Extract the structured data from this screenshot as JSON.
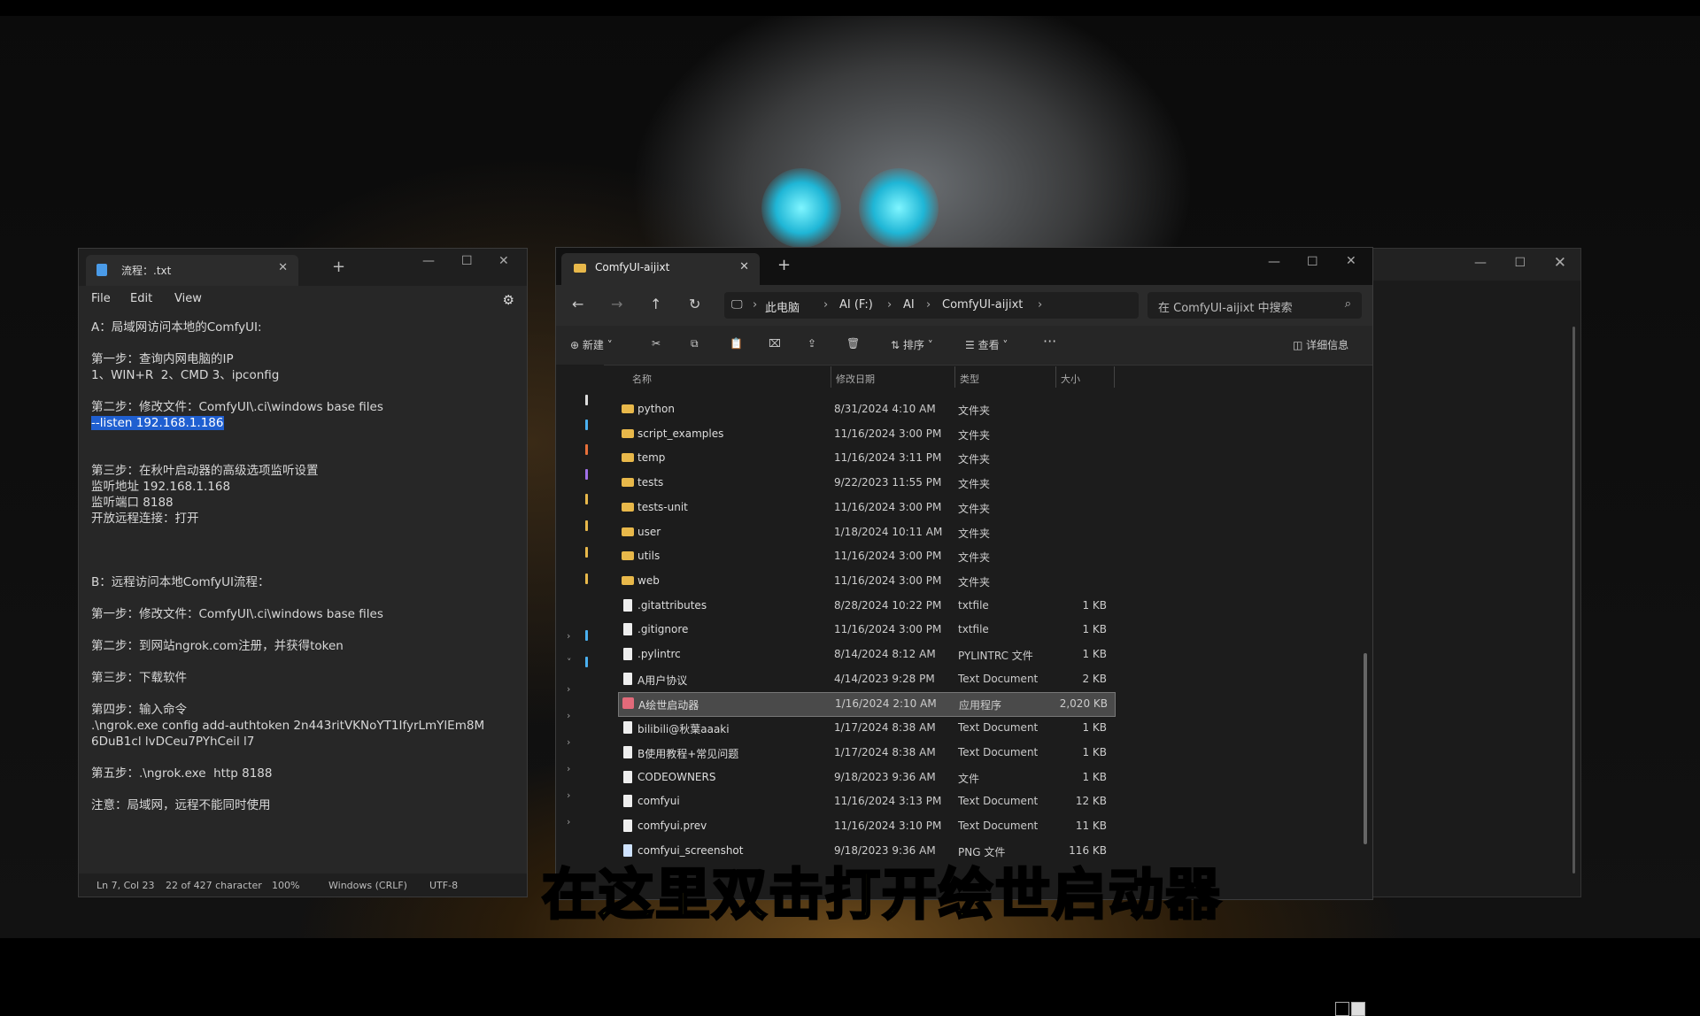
{
  "notepad": {
    "tab_title": "流程：.txt",
    "menu": [
      "File",
      "Edit",
      "View"
    ],
    "lines": [
      "A：局域网访问本地的ComfyUI:",
      "",
      "第一步：查询内网电脑的IP",
      "1、WIN+R  2、CMD 3、ipconfig",
      "",
      "第二步：修改文件：ComfyUI\\.ci\\windows base files",
      "",
      "",
      "第三步：在秋叶启动器的高级选项监听设置",
      "监听地址 192.168.1.168",
      "监听端口 8188",
      "开放远程连接：打开",
      "",
      "",
      "",
      "B：远程访问本地ComfyUI流程：",
      "",
      "第一步：修改文件：ComfyUI\\.ci\\windows base files",
      "",
      "第二步：到网站ngrok.com注册，并获得token",
      "",
      "第三步：下载软件",
      "",
      "第四步：输入命令",
      ".\\ngrok.exe config add-authtoken 2n443ritVKNoYT1IfyrLmYlEm8M",
      "6DuB1cl lvDCeu7PYhCeil l7",
      "",
      "第五步：.\\ngrok.exe  http 8188",
      "",
      "注意：局域网，远程不能同时使用"
    ],
    "highlight_line": "--listen 192.168.1.186",
    "status": {
      "position": "Ln 7, Col 23",
      "chars": "22 of 427 character",
      "zoom": "100%",
      "line_ending": "Windows (CRLF)",
      "encoding": "UTF-8"
    }
  },
  "explorer": {
    "tab_title": "ComfyUI-aijixt",
    "breadcrumb": [
      "此电脑",
      "AI (F:)",
      "AI",
      "ComfyUI-aijixt"
    ],
    "search_placeholder": "在 ComfyUI-aijixt 中搜索",
    "toolbar": {
      "new": "新建",
      "sort": "排序",
      "view": "查看",
      "details": "详细信息"
    },
    "columns": [
      "名称",
      "修改日期",
      "类型",
      "大小"
    ],
    "files": [
      {
        "name": "python",
        "date": "8/31/2024 4:10 AM",
        "type": "文件夹",
        "size": "",
        "kind": "folder"
      },
      {
        "name": "script_examples",
        "date": "11/16/2024 3:00 PM",
        "type": "文件夹",
        "size": "",
        "kind": "folder"
      },
      {
        "name": "temp",
        "date": "11/16/2024 3:11 PM",
        "type": "文件夹",
        "size": "",
        "kind": "folder"
      },
      {
        "name": "tests",
        "date": "9/22/2023 11:55 PM",
        "type": "文件夹",
        "size": "",
        "kind": "folder"
      },
      {
        "name": "tests-unit",
        "date": "11/16/2024 3:00 PM",
        "type": "文件夹",
        "size": "",
        "kind": "folder"
      },
      {
        "name": "user",
        "date": "1/18/2024 10:11 AM",
        "type": "文件夹",
        "size": "",
        "kind": "folder"
      },
      {
        "name": "utils",
        "date": "11/16/2024 3:00 PM",
        "type": "文件夹",
        "size": "",
        "kind": "folder"
      },
      {
        "name": "web",
        "date": "11/16/2024 3:00 PM",
        "type": "文件夹",
        "size": "",
        "kind": "folder"
      },
      {
        "name": ".gitattributes",
        "date": "8/28/2024 10:22 PM",
        "type": "txtfile",
        "size": "1 KB",
        "kind": "file"
      },
      {
        "name": ".gitignore",
        "date": "11/16/2024 3:00 PM",
        "type": "txtfile",
        "size": "1 KB",
        "kind": "file"
      },
      {
        "name": ".pylintrc",
        "date": "8/14/2024 8:12 AM",
        "type": "PYLINTRC 文件",
        "size": "1 KB",
        "kind": "file"
      },
      {
        "name": "A用户协议",
        "date": "4/14/2023 9:28 PM",
        "type": "Text Document",
        "size": "2 KB",
        "kind": "file"
      },
      {
        "name": "A绘世启动器",
        "date": "1/16/2024 2:10 AM",
        "type": "应用程序",
        "size": "2,020 KB",
        "kind": "app",
        "selected": true
      },
      {
        "name": "bilibili@秋葉aaaki",
        "date": "1/17/2024 8:38 AM",
        "type": "Text Document",
        "size": "1 KB",
        "kind": "file"
      },
      {
        "name": "B使用教程+常见问题",
        "date": "1/17/2024 8:38 AM",
        "type": "Text Document",
        "size": "1 KB",
        "kind": "file"
      },
      {
        "name": "CODEOWNERS",
        "date": "9/18/2023 9:36 AM",
        "type": "文件",
        "size": "1 KB",
        "kind": "file"
      },
      {
        "name": "comfyui",
        "date": "11/16/2024 3:13 PM",
        "type": "Text Document",
        "size": "12 KB",
        "kind": "file"
      },
      {
        "name": "comfyui.prev",
        "date": "11/16/2024 3:10 PM",
        "type": "Text Document",
        "size": "11 KB",
        "kind": "file"
      },
      {
        "name": "comfyui_screenshot",
        "date": "9/18/2023 9:36 AM",
        "type": "PNG 文件",
        "size": "116 KB",
        "kind": "png"
      }
    ]
  },
  "subtitle": "在这里双击打开绘世启动器"
}
